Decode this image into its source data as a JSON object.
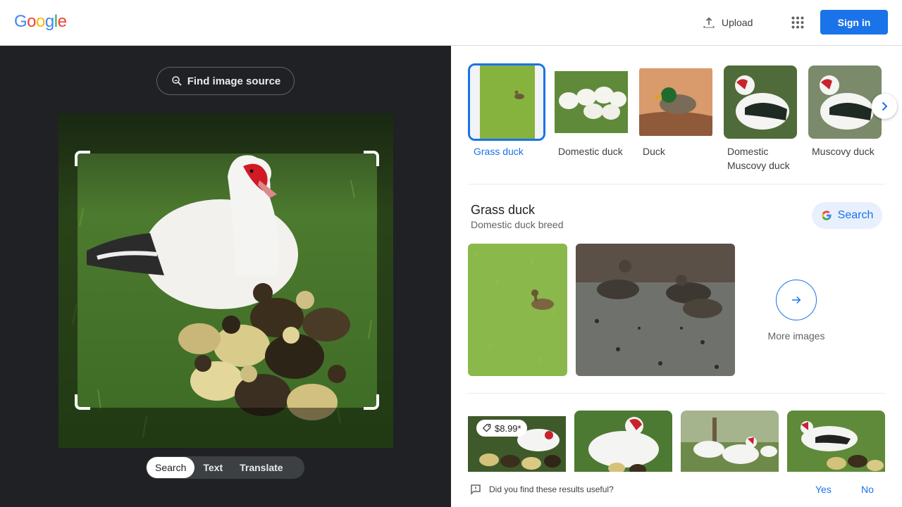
{
  "header": {
    "logo_letters": [
      {
        "ch": "G",
        "color": "#4285F4"
      },
      {
        "ch": "o",
        "color": "#EA4335"
      },
      {
        "ch": "o",
        "color": "#FBBC05"
      },
      {
        "ch": "g",
        "color": "#4285F4"
      },
      {
        "ch": "l",
        "color": "#34A853"
      },
      {
        "ch": "e",
        "color": "#EA4335"
      }
    ],
    "upload_label": "Upload",
    "apps_icon": "apps-grid-icon",
    "signin_label": "Sign in"
  },
  "left_panel": {
    "find_source_label": "Find image source",
    "modes": [
      {
        "label": "Search",
        "active": true
      },
      {
        "label": "Text",
        "active": false
      },
      {
        "label": "Translate",
        "active": false
      }
    ]
  },
  "chips": [
    {
      "label": "Grass duck",
      "selected": true
    },
    {
      "label": "Domestic duck",
      "selected": false
    },
    {
      "label": "Duck",
      "selected": false
    },
    {
      "label": "Domestic Muscovy duck",
      "selected": false
    },
    {
      "label": "Muscovy duck",
      "selected": false
    }
  ],
  "entity": {
    "title": "Grass duck",
    "subtitle": "Domestic duck breed",
    "search_label": "Search",
    "more_images_label": "More images"
  },
  "results": [
    {
      "price": "$8.99*"
    },
    {
      "price": ""
    },
    {
      "price": ""
    },
    {
      "price": ""
    }
  ],
  "feedback": {
    "question": "Did you find these results useful?",
    "yes": "Yes",
    "no": "No"
  },
  "colors": {
    "accent": "#1a73e8",
    "left_bg": "#202124"
  }
}
